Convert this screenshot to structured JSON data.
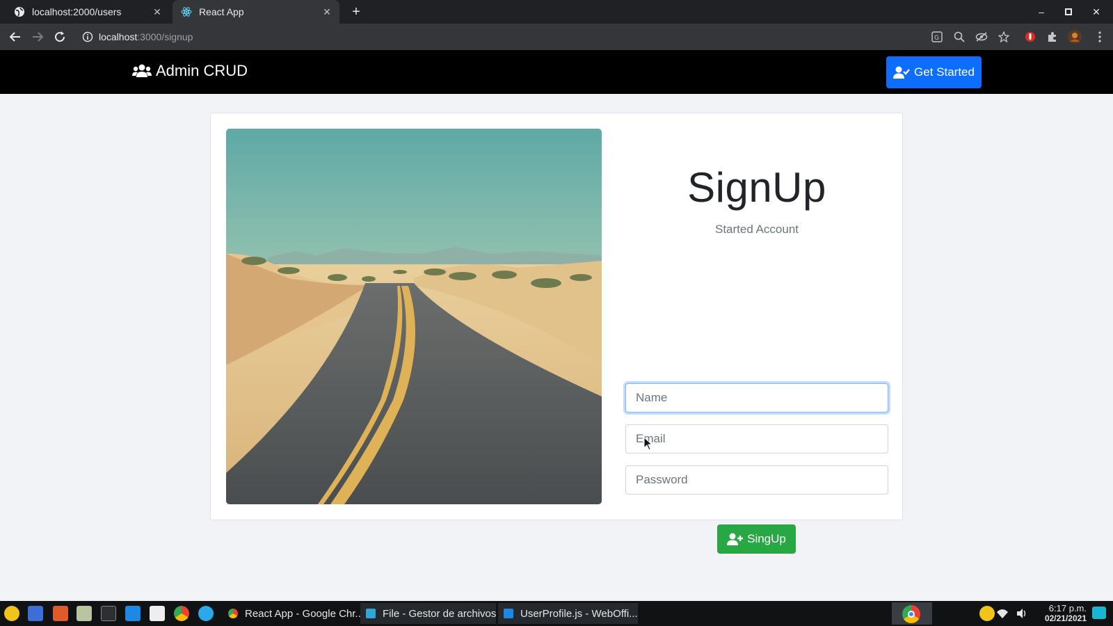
{
  "browser": {
    "tabs": [
      {
        "title": "localhost:2000/users",
        "active": false
      },
      {
        "title": "React App",
        "active": true
      }
    ],
    "url_host": "localhost",
    "url_path": ":3000/signup"
  },
  "navbar": {
    "brand": "Admin CRUD",
    "cta_label": "Get Started",
    "cta_color": "#0d6efd"
  },
  "signup": {
    "title": "SignUp",
    "subtitle": "Started Account",
    "name_placeholder": "Name",
    "email_placeholder": "Email",
    "password_placeholder": "Password",
    "submit_label": "SingUp",
    "submit_color": "#28a745"
  },
  "taskbar": {
    "tasks": [
      {
        "label": "React App - Google Chr..."
      },
      {
        "label": "File - Gestor de archivos"
      },
      {
        "label": "UserProfile.js - WebOffi..."
      }
    ],
    "time": "6:17 p.m.",
    "date": "02/21/2021"
  }
}
